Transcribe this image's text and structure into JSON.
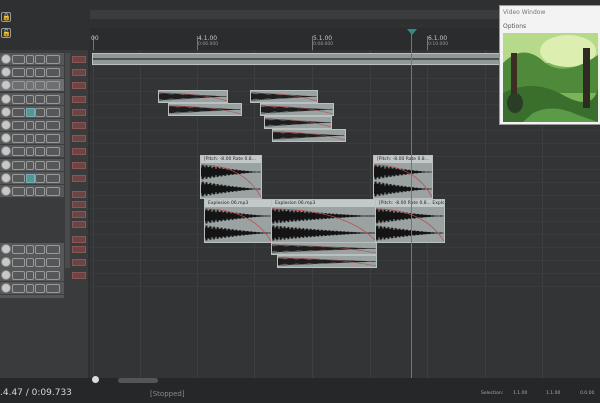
{
  "ruler": {
    "ticks": [
      {
        "label": "00",
        "sub": ""
      },
      {
        "label": "4.1.00",
        "sub": "0:06.000"
      },
      {
        "label": "5.1.00",
        "sub": "0:08.000"
      },
      {
        "label": "6.1.00",
        "sub": "0:10.000"
      }
    ]
  },
  "items": {
    "pitch_label_1": "[Pitch: -8.00 Rate 0.8...",
    "pitch_label_2": "[Pitch: -8.00 Rate 0.8...",
    "explosion_1": "Explosion 06.mp3",
    "explosion_2": "Explosion 06.mp3",
    "explosion_3": "[Pitch: -8.00 Rate 0.8... Explosion 06..."
  },
  "video_window": {
    "title": "Video Window",
    "options": "Options"
  },
  "status": {
    "time": ".4.47 / 0:09.733",
    "state": "[Stopped]",
    "selection_label": "Selection:",
    "selection_start": "1.1.00",
    "selection_end": "1.1.00",
    "selection_length": "0.0.00"
  },
  "colors": {
    "playhead": "#2e8e86",
    "item_body": "#9aa2a2",
    "track_selected": "#6d6f70",
    "background": "#2f3031"
  }
}
